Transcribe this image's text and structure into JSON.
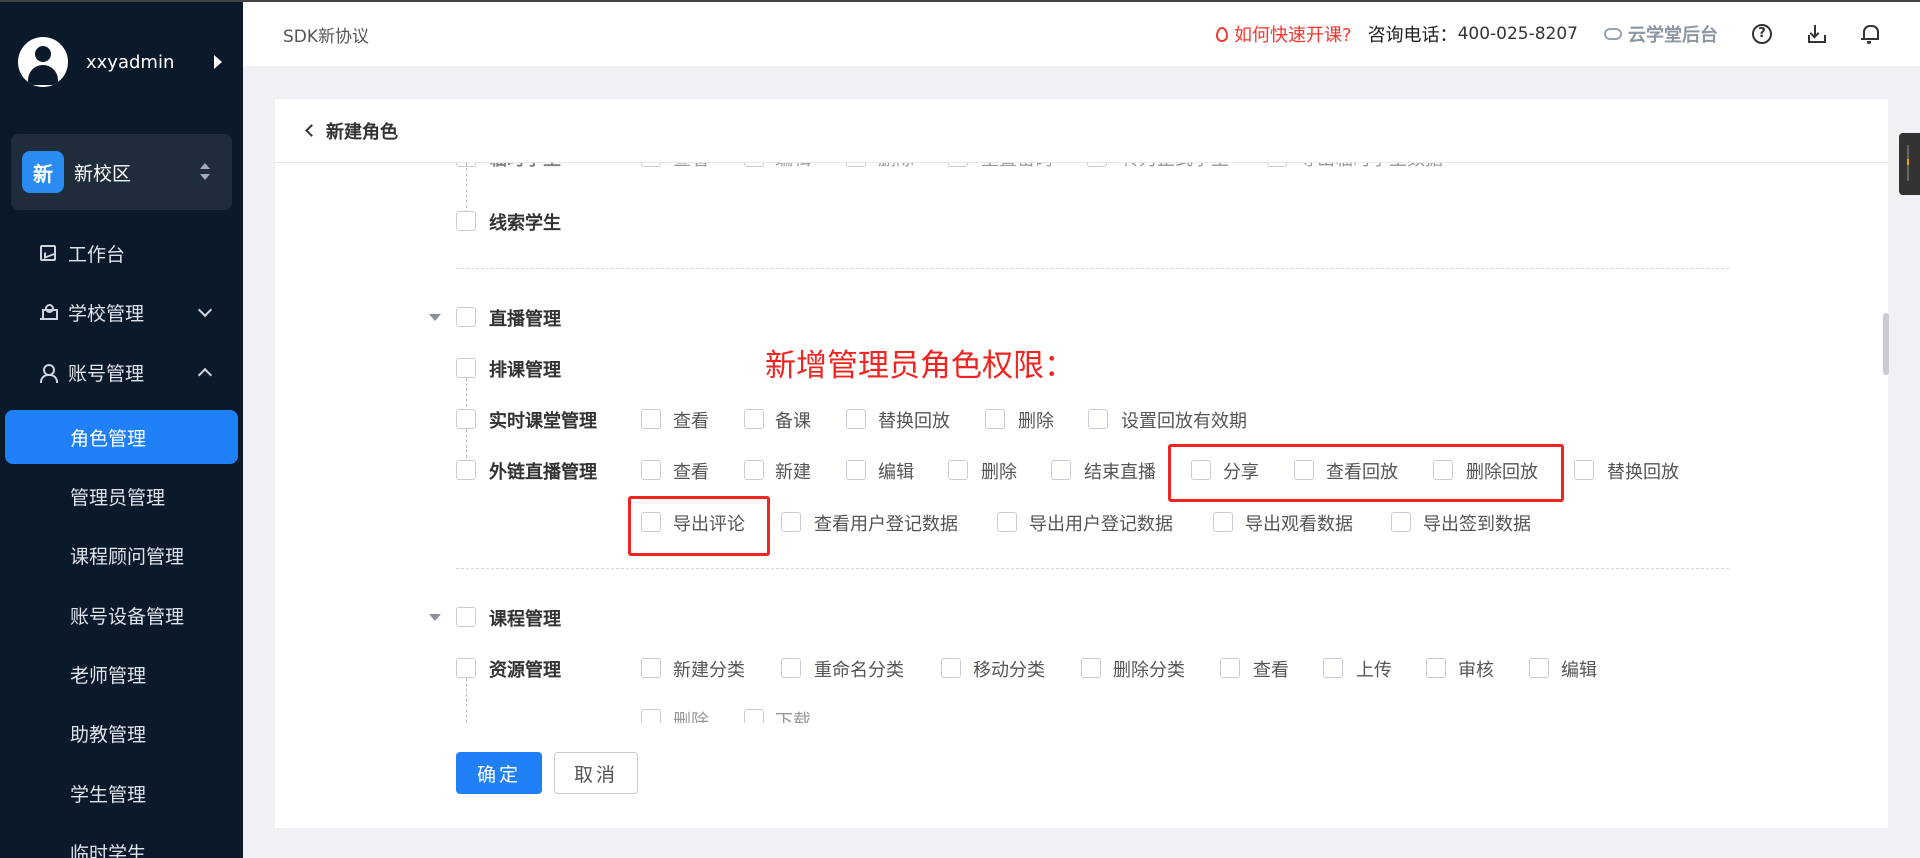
{
  "sidebar": {
    "username": "xxyadmin",
    "campus_badge": "新",
    "campus_name": "新校区",
    "nav": [
      {
        "label": "工作台"
      },
      {
        "label": "学校管理"
      },
      {
        "label": "账号管理"
      }
    ],
    "sub": [
      {
        "label": "角色管理"
      },
      {
        "label": "管理员管理"
      },
      {
        "label": "课程顾问管理"
      },
      {
        "label": "账号设备管理"
      },
      {
        "label": "老师管理"
      },
      {
        "label": "助教管理"
      },
      {
        "label": "学生管理"
      },
      {
        "label": "临时学生"
      }
    ]
  },
  "header": {
    "breadcrumb": "SDK新协议",
    "fast_link": "如何快速开课?",
    "phone_label": "咨询电话：",
    "phone_number": "400-025-8207",
    "backend_link": "云学堂后台",
    "help_glyph": "?"
  },
  "card": {
    "title": "新建角色"
  },
  "tree": {
    "temp_student": {
      "label": "临时学生",
      "perms": [
        "查看",
        "编辑",
        "删除",
        "重置密码",
        "转为正式学生",
        "导出临时学生数据"
      ]
    },
    "lead_student": {
      "label": "线索学生"
    },
    "live": {
      "label": "直播管理",
      "schedule": {
        "label": "排课管理"
      },
      "realtime": {
        "label": "实时课堂管理",
        "perms": [
          "查看",
          "备课",
          "替换回放",
          "删除",
          "设置回放有效期"
        ]
      },
      "external": {
        "label": "外链直播管理",
        "perms_line1": [
          "查看",
          "新建",
          "编辑",
          "删除",
          "结束直播",
          "分享",
          "查看回放",
          "删除回放",
          "替换回放"
        ],
        "perms_line2": [
          "导出评论",
          "查看用户登记数据",
          "导出用户登记数据",
          "导出观看数据",
          "导出签到数据"
        ]
      }
    },
    "course": {
      "label": "课程管理",
      "resource": {
        "label": "资源管理",
        "perms_line1": [
          "新建分类",
          "重命名分类",
          "移动分类",
          "删除分类",
          "查看",
          "上传",
          "审核",
          "编辑"
        ],
        "perms_line2": [
          "删除",
          "下载"
        ]
      }
    }
  },
  "annotation": "新增管理员角色权限：",
  "buttons": {
    "ok": "确定",
    "cancel": "取消"
  },
  "colors": {
    "sidebar_bg": "#0b1a2a",
    "accent": "#2080f7",
    "annotation_red": "#f02420"
  }
}
